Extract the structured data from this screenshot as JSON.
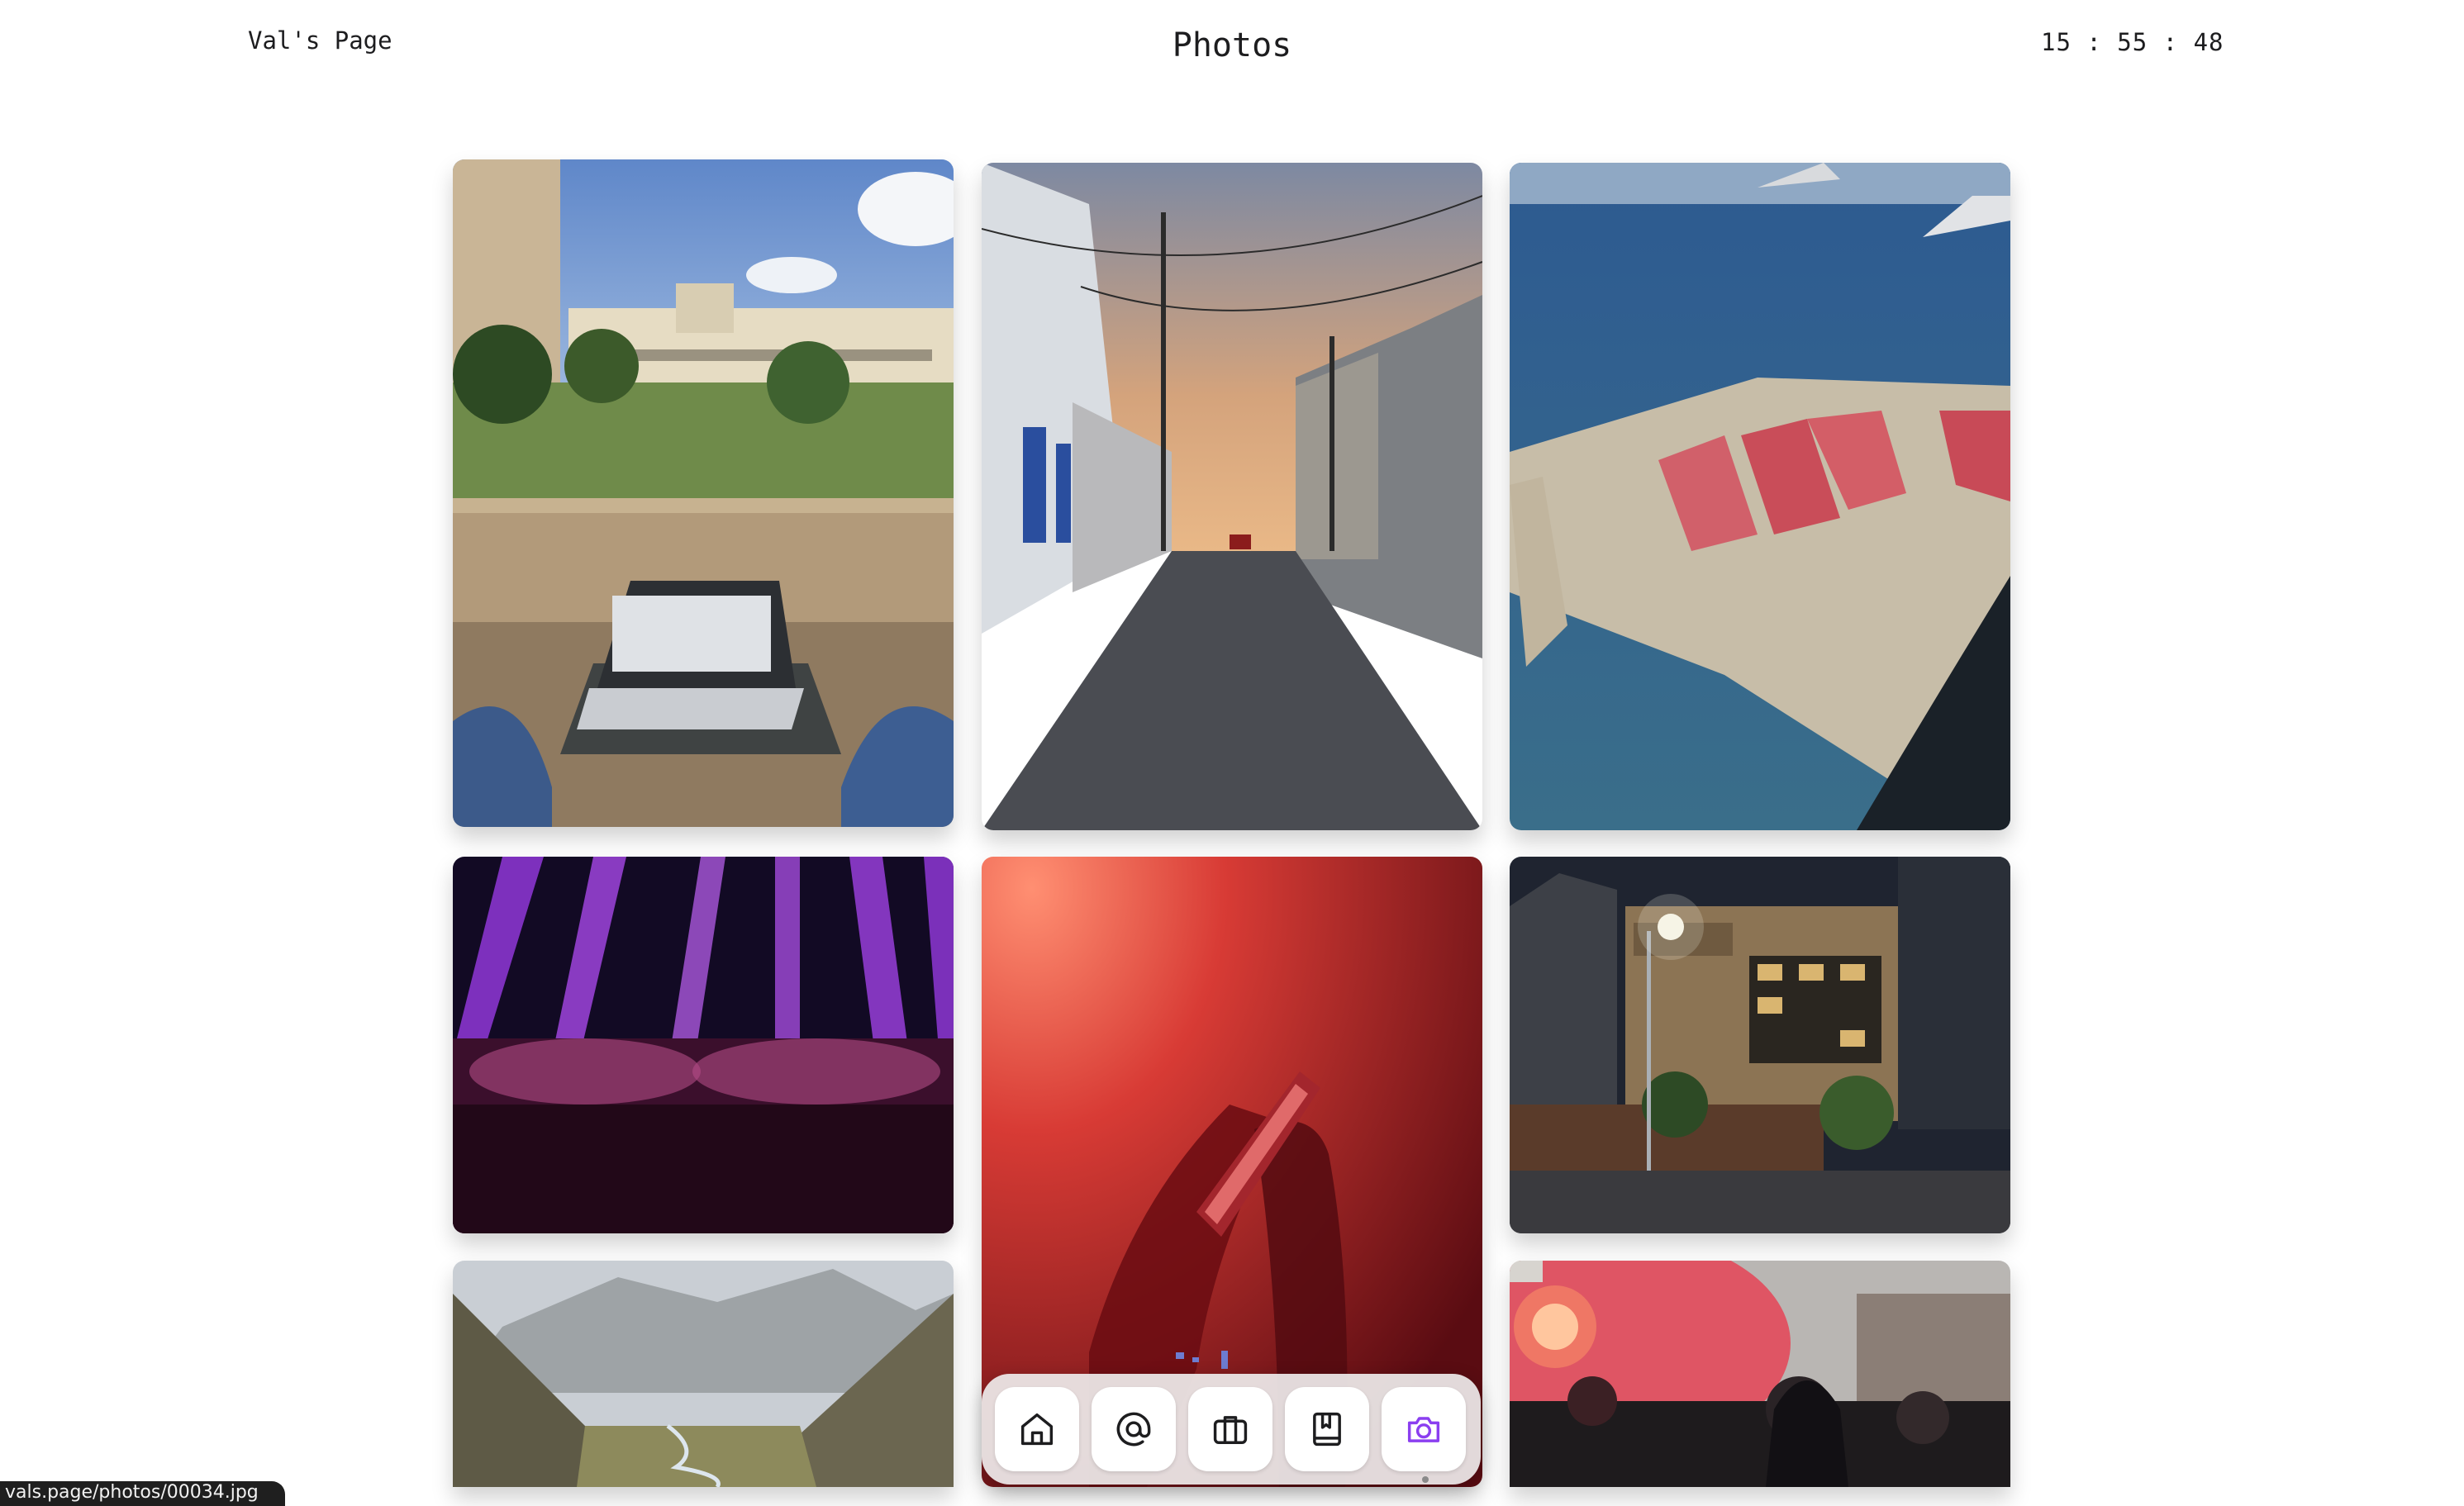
{
  "header": {
    "site_name": "Val's Page",
    "page_title": "Photos",
    "clock": "15 : 55 : 48"
  },
  "status_bar": {
    "link_url": "vals.page/photos/00034.jpg"
  },
  "dock": {
    "items": [
      {
        "icon": "home-icon"
      },
      {
        "icon": "at-sign-icon"
      },
      {
        "icon": "briefcase-icon"
      },
      {
        "icon": "book-icon"
      },
      {
        "icon": "camera-icon",
        "active": true
      }
    ],
    "active_color": "#8b3ff0"
  },
  "photos": [
    {
      "subject": "laptop-courtyard"
    },
    {
      "subject": "narrow-street-sunset"
    },
    {
      "subject": "aerial-salt-flats"
    },
    {
      "subject": "concert-purple-lights"
    },
    {
      "subject": "red-concert-phone"
    },
    {
      "subject": "night-building-lamp"
    },
    {
      "subject": "mountain-valley"
    },
    {
      "subject": "protest-red-flare"
    }
  ]
}
